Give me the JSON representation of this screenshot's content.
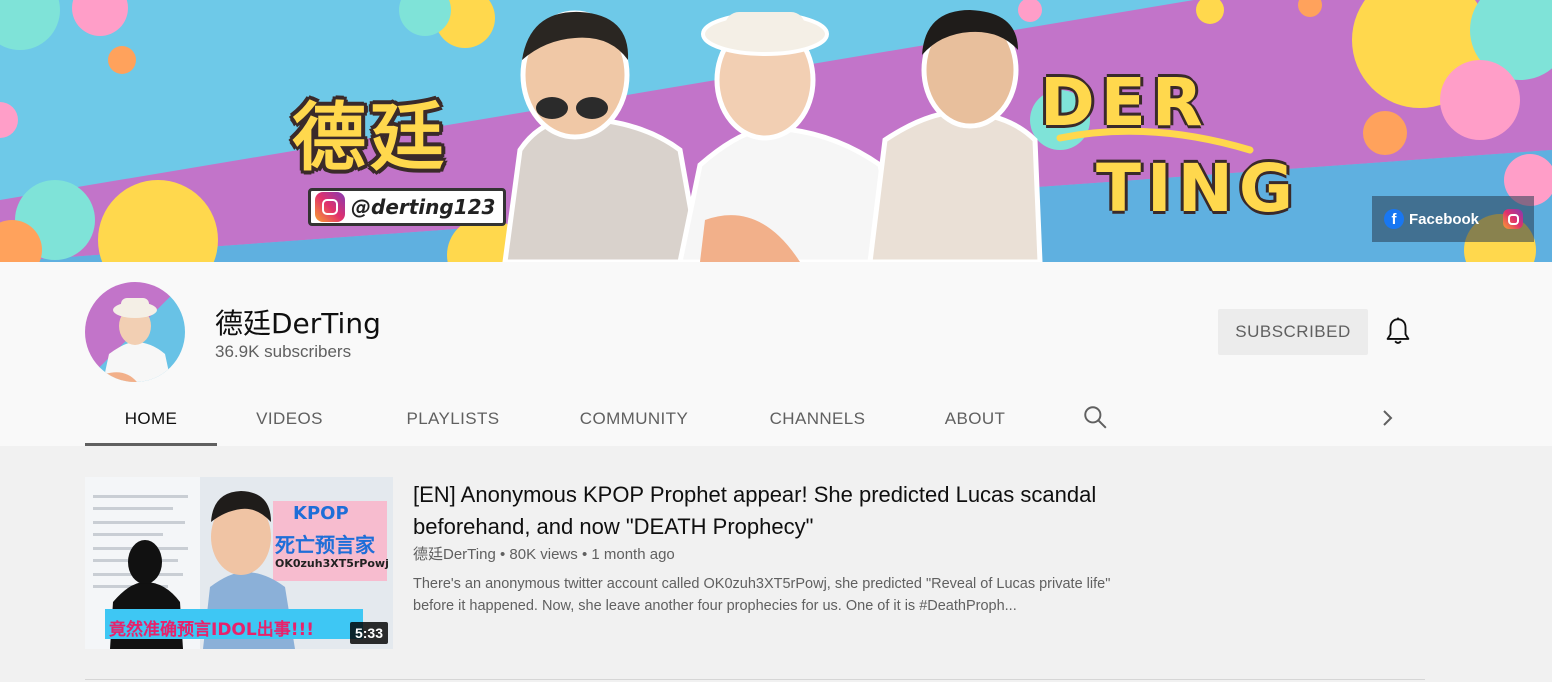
{
  "banner": {
    "title_cn": "德廷",
    "handle": "@derting123",
    "logo_line1": "DER",
    "logo_line2": "TING",
    "facebook_label": "Facebook",
    "colors": {
      "sky": "#6ec9e8",
      "stripe": "#c274c9",
      "yellow": "#ffd84d"
    }
  },
  "channel": {
    "name": "德廷DerTing",
    "subscribers": "36.9K subscribers",
    "subscribe_label": "SUBSCRIBED"
  },
  "tabs": [
    "HOME",
    "VIDEOS",
    "PLAYLISTS",
    "COMMUNITY",
    "CHANNELS",
    "ABOUT"
  ],
  "active_tab": "HOME",
  "video": {
    "title": "[EN] Anonymous KPOP Prophet appear! She predicted Lucas scandal beforehand, and now \"DEATH Prophecy\"",
    "channel": "德廷DerTing",
    "views": "80K views",
    "age": "1 month ago",
    "description": "There's an anonymous twitter account called OK0zuh3XT5rPowj, she predicted \"Reveal of Lucas private life\" before it happened. Now, she leave another four prophecies for us. One of it is #DeathProph...",
    "duration": "5:33",
    "thumb_kpop": "KPOP",
    "thumb_cn_title": "死亡预言家",
    "thumb_account": "OK0zuh3XT5rPowj",
    "thumb_caption": "竟然准确预言IDOL出事!!!"
  }
}
